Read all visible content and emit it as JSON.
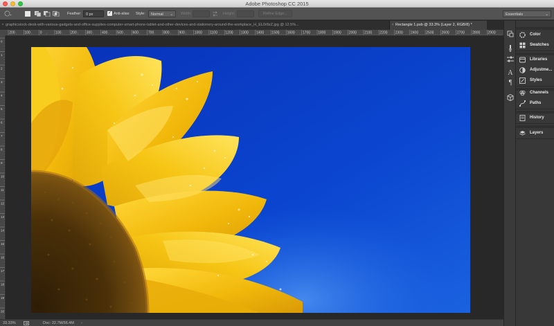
{
  "window": {
    "title": "Adobe Photoshop CC 2015"
  },
  "options_bar": {
    "feather_label": "Feather:",
    "feather_value": "0 px",
    "anti_alias_label": "Anti-alias",
    "anti_alias_checked": true,
    "style_label": "Style:",
    "style_value": "Normal",
    "width_label": "Width:",
    "height_label": "Height:",
    "refine_edge_label": "Refine Edge...",
    "workspace": "Essentials"
  },
  "tabs": [
    {
      "label": "graphicstock-desk-with-various-gadgets-and-office-supplies-computer-smart-phone-tablet-and-other-devices-and-stationery-around-the-workplace_H_EL0r8zZ.jpg @ 12.5%...",
      "active": false,
      "close": "×"
    },
    {
      "label": "Rectangle 1.psb @ 33.3% (Layer 2, RGB/8) *",
      "active": true,
      "close": "×"
    }
  ],
  "ruler_top": [
    "200",
    "100",
    "0",
    "100",
    "200",
    "300",
    "400",
    "500",
    "600",
    "700",
    "800",
    "900",
    "1000",
    "1100",
    "1200",
    "1300",
    "1400",
    "1500",
    "1600",
    "1700",
    "1800",
    "1900",
    "2000",
    "2100",
    "2200",
    "2300",
    "2400",
    "2500",
    "2600",
    "2700",
    "2800",
    "2900"
  ],
  "ruler_left": [
    "0",
    "1",
    "2",
    "3",
    "4",
    "5",
    "6",
    "7",
    "8",
    "9",
    "10",
    "11",
    "12",
    "13",
    "14",
    "15",
    "16",
    "17",
    "18",
    "19",
    "20"
  ],
  "status_bar": {
    "zoom": "33.33%",
    "doc_info": "Doc: 22.7M/56.4M"
  },
  "panels": [
    {
      "group": 1,
      "items": [
        {
          "label": "Color",
          "icon": "color-wheel-icon"
        },
        {
          "label": "Swatches",
          "icon": "swatches-grid-icon"
        }
      ]
    },
    {
      "group": 2,
      "items": [
        {
          "label": "Libraries",
          "icon": "libraries-icon"
        },
        {
          "label": "Adjustme...",
          "icon": "adjustments-icon"
        },
        {
          "label": "Styles",
          "icon": "styles-fx-icon"
        }
      ]
    },
    {
      "group": 3,
      "items": [
        {
          "label": "Channels",
          "icon": "channels-icon"
        },
        {
          "label": "Paths",
          "icon": "paths-icon"
        }
      ]
    },
    {
      "group": 4,
      "items": [
        {
          "label": "History",
          "icon": "history-icon"
        }
      ]
    },
    {
      "group": 5,
      "items": [
        {
          "label": "Layers",
          "icon": "layers-icon"
        }
      ]
    }
  ],
  "colors": {
    "ui_dark": "#282828",
    "ui_panel": "#383838",
    "sky_blue": "#0a3fc4",
    "petal_yellow": "#f5c40f",
    "flower_center": "#5b3c0c"
  }
}
